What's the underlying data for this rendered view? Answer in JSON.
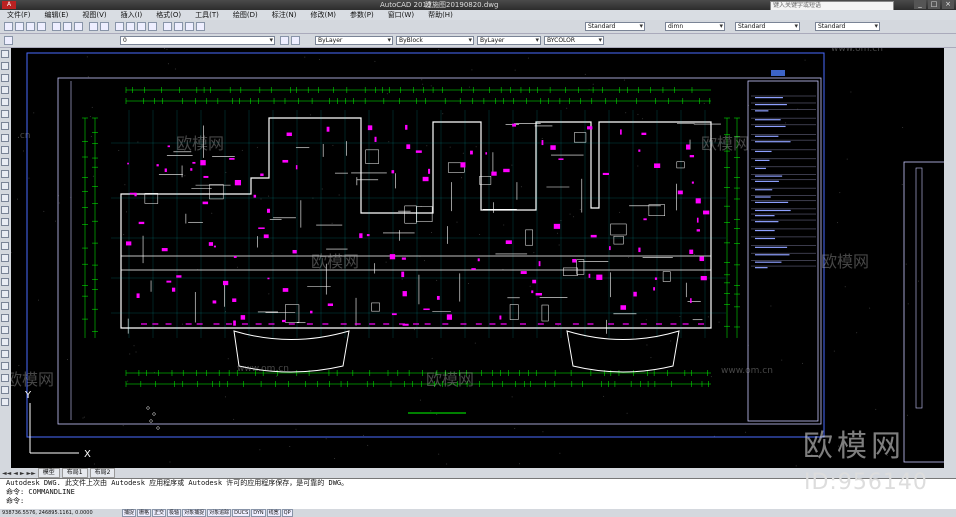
{
  "title_bar": {
    "app": "AutoCAD 2010",
    "file": "建施图20190820.dwg",
    "help_search_placeholder": "键入关键字或短语",
    "window_buttons": [
      "_",
      "□",
      "×"
    ]
  },
  "menu": [
    "文件(F)",
    "编辑(E)",
    "视图(V)",
    "插入(I)",
    "格式(O)",
    "工具(T)",
    "绘图(D)",
    "标注(N)",
    "修改(M)",
    "参数(P)",
    "窗口(W)",
    "帮助(H)"
  ],
  "toolbar_styles": {
    "text_style": "Standard",
    "dim_style": "dimn",
    "table_style": "Standard",
    "multileader_style": "Standard"
  },
  "layer_toolbar": {
    "layer": "0",
    "color": "ByLayer",
    "linetype": "ByBlock",
    "lineweight": "ByLayer",
    "plotstyle": "BYCOLOR"
  },
  "tabs": [
    "模型",
    "布局1",
    "布局2"
  ],
  "tab_nav": [
    "◄◄",
    "◄",
    "►",
    "►►"
  ],
  "command_lines": [
    "Autodesk DWG.  此文件上次由 Autodesk 应用程序或 Autodesk 许可的应用程序保存，是可靠的 DWG。",
    "命令: COMMANDLINE",
    "命令:"
  ],
  "status": {
    "coords": "938736.5576, 246895.1161, 0.0000",
    "buttons": [
      "捕捉",
      "栅格",
      "正交",
      "极轴",
      "对象捕捉",
      "对象追踪",
      "DUCS",
      "DYN",
      "线宽",
      "QP"
    ]
  },
  "watermarks": {
    "brand": "欧模网",
    "site": "www.om.cn",
    "site_short": ".cn",
    "id_text": "ID:956140"
  },
  "axis_labels": {
    "x": "X",
    "y": "Y"
  },
  "colors": {
    "drawing_bg": "#000000",
    "wall": "#ffffff",
    "door": "#ff00ff",
    "dim": "#00ff00",
    "grid": "#00ffff",
    "frame": "#4a6bff"
  }
}
